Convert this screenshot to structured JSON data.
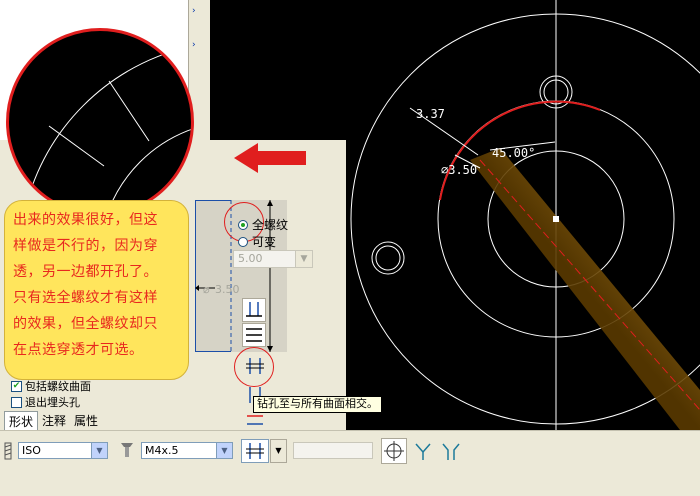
{
  "callout": {
    "lines": [
      "出来的效果很好，但这",
      "样做是不行的，因为穿",
      "透，另一边都开孔了。",
      "只有选全螺纹才有这样",
      "的效果，但全螺纹却只",
      "在点选穿透才可选。"
    ]
  },
  "dimensions": {
    "d1": "3.37",
    "d2": "3.50",
    "angle": "45.00°",
    "diameter_preview": "3.50"
  },
  "thread_options": {
    "full_thread_label": "全螺纹",
    "variable_label": "可变",
    "depth_value": "5.00"
  },
  "tooltip": "钻孔至与所有曲面相交。",
  "checkboxes": {
    "include_thread_surface": "包括螺纹曲面",
    "exit_countersink": "退出埋头孔"
  },
  "tabs": [
    "形状",
    "注释",
    "属性"
  ],
  "toolbar": {
    "standard_value": "ISO",
    "screw_size_value": "M4x.5"
  },
  "colors": {
    "accent_red": "#e01e1e",
    "callout_bg": "#ffe55c",
    "callout_text": "#e8281e",
    "panel_bg": "#ece9d8",
    "cad_bg": "#000000",
    "hole_orange": "#c78a14"
  }
}
